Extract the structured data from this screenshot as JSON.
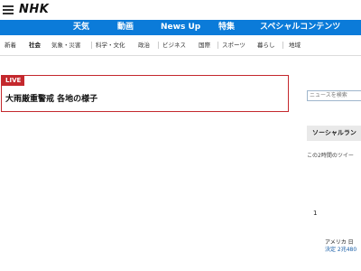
{
  "header": {
    "logo": "NHK"
  },
  "nav": {
    "items": [
      {
        "label": "天気"
      },
      {
        "label": "動画"
      },
      {
        "label": "News Up"
      },
      {
        "label": "特集"
      },
      {
        "label": "スペシャルコンテンツ"
      }
    ]
  },
  "categories": {
    "items": [
      {
        "label": "新着"
      },
      {
        "label": "社会"
      },
      {
        "label": "気象・災害"
      },
      {
        "label": "科学・文化"
      },
      {
        "label": "政治"
      },
      {
        "label": "ビジネス"
      },
      {
        "label": "国際"
      },
      {
        "label": "スポーツ"
      },
      {
        "label": "暮らし"
      },
      {
        "label": "地域"
      }
    ],
    "active": "社会"
  },
  "live": {
    "badge": "LIVE",
    "title": "大雨厳重警戒 各地の様子"
  },
  "search": {
    "placeholder": "ニュースを検索"
  },
  "ranking": {
    "heading": "ソーシャルラン",
    "subtitle": "この2時間のツイー",
    "first_rank": "1",
    "first_line1": "アメリカ 日",
    "first_line2": "決定 2兆480"
  },
  "colors": {
    "nav_blue": "#0b7bd9",
    "live_red": "#c4282d"
  }
}
